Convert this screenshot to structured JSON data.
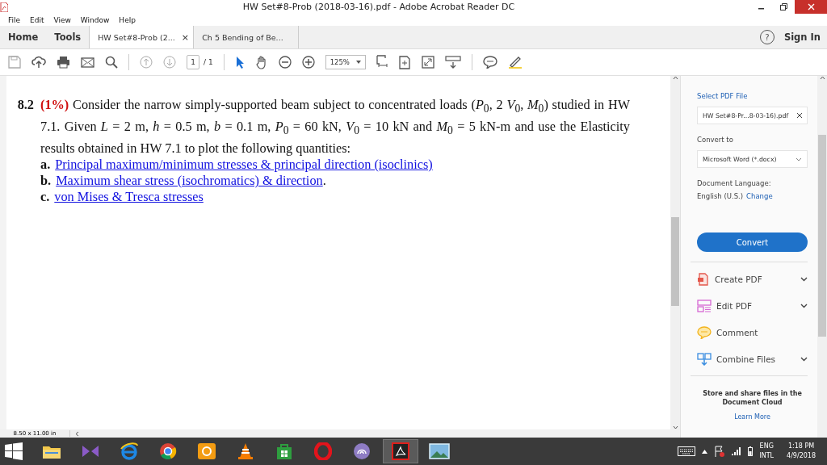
{
  "window": {
    "title": "HW Set#8-Prob (2018-03-16).pdf - Adobe Acrobat Reader DC"
  },
  "menu": [
    "File",
    "Edit",
    "View",
    "Window",
    "Help"
  ],
  "tabs": [
    {
      "label": "Home",
      "kind": "nav",
      "selected": false
    },
    {
      "label": "Tools",
      "kind": "nav",
      "selected": false
    },
    {
      "label": "HW Set#8-Prob (2...",
      "kind": "doc",
      "close": "×",
      "selected": true
    },
    {
      "label": "Ch 5 Bending of Be...",
      "kind": "doc",
      "selected": false
    }
  ],
  "help": "?",
  "sign_in": "Sign In",
  "toolbar": {
    "page": "1",
    "pages": "/ 1",
    "zoom": "125%"
  },
  "document": {
    "number": "8.2",
    "weight": "(1%)",
    "text": "Consider the narrow simply-supported beam subject to concentrated loads (*P*$_{0}$, 2 *V*$_{0}$, *M*$_{0}$) studied in HW 7.1. Given *L* = 2 m, *h* = 0.5 m, *b* = 0.1 m, *P*$_{0}$ = 60 kN, *V*$_{0}$ = 10 kN and *M*$_{0}$ = 5 kN-m and use the Elasticity results obtained in HW 7.1 to plot the following quantities:",
    "items": [
      {
        "letter": "a.",
        "link": "Principal maximum/minimum stresses & principal direction (isoclinics)"
      },
      {
        "letter": "b.",
        "link": "Maximum shear stress (isochromatics) & direction",
        "after": "."
      },
      {
        "letter": "c.",
        "link": "von Mises & Tresca stresses"
      }
    ]
  },
  "page_size": "8.50 x 11.00 in",
  "pane": {
    "select_label": "Select PDF File",
    "file": "HW Set#8-Pr...8-03-16).pdf",
    "convert_label": "Convert to",
    "format": "Microsoft Word (*.docx)",
    "language_label": "Document Language:",
    "language": "English (U.S.)",
    "change": "Change",
    "convert": "Convert",
    "tools": [
      {
        "label": "Create PDF",
        "kind": "create",
        "expandable": true
      },
      {
        "label": "Edit PDF",
        "kind": "edit",
        "expandable": true
      },
      {
        "label": "Comment",
        "kind": "comment",
        "expandable": false
      },
      {
        "label": "Combine Files",
        "kind": "combine",
        "expandable": true
      }
    ],
    "cloud": "Store and share files in the Document Cloud",
    "learn_more": "Learn More"
  },
  "taskbar": {
    "apps": [
      {
        "kind": "folder",
        "selected": false
      },
      {
        "kind": "bowtie",
        "selected": false
      },
      {
        "kind": "e",
        "selected": false
      },
      {
        "kind": "chrome",
        "selected": false
      },
      {
        "kind": "squirrel",
        "selected": false
      },
      {
        "kind": "cone",
        "selected": false
      },
      {
        "kind": "bag",
        "selected": false
      },
      {
        "kind": "ring",
        "selected": false
      },
      {
        "kind": "swirl",
        "selected": false
      },
      {
        "kind": "acrobat",
        "selected": true
      },
      {
        "kind": "photo",
        "selected": false
      }
    ],
    "lang": "ENG",
    "layout": "INTL",
    "time": "1:18 PM",
    "date": "4/9/2018"
  }
}
